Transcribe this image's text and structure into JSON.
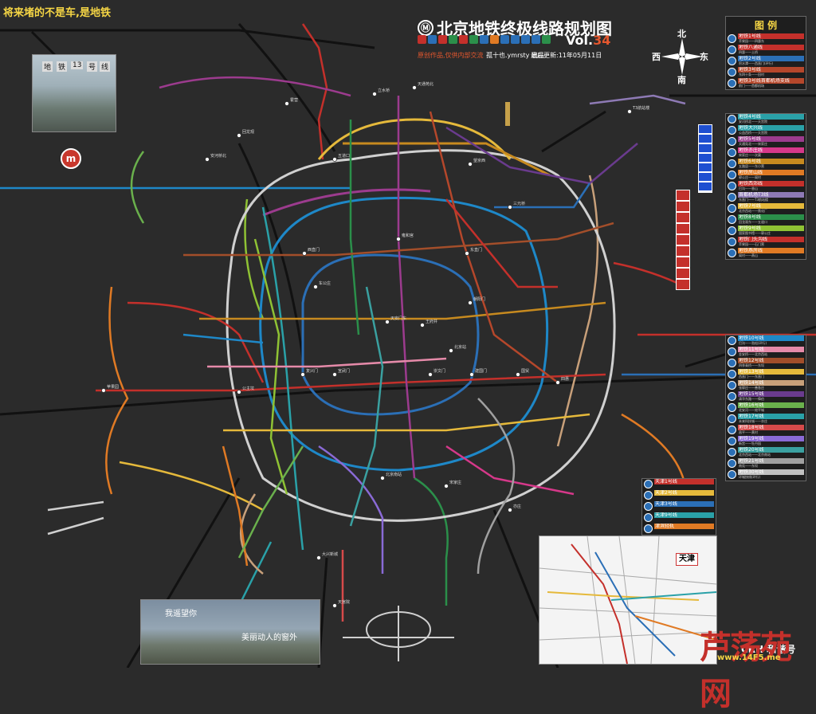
{
  "map": {
    "title": "北京地铁终极线路规划图",
    "vol_prefix": "Vol.",
    "vol_number": "34",
    "slogan": "将来堵的不是车,是地铁",
    "credit_left": "原创作品,仅供内部交流",
    "credit_author": "孤十也.ymrsty 出品",
    "updated": "最后更新:11年05月11日",
    "compass": {
      "north": "北",
      "south": "南",
      "west": "西",
      "east": "东"
    },
    "photo1_labels": [
      "地",
      "铁",
      "13",
      "号",
      "线"
    ],
    "photo2_caption_1": "我遥望你",
    "photo2_caption_2": "美丽动人的窗外",
    "inset_label": "天津",
    "watermark": "芦荡苑网",
    "watermark_url": "www.14F5.me",
    "crh_label": "CRH 和谐号",
    "logo_letter": "m"
  },
  "legend": {
    "title": "图 例",
    "group1": [
      {
        "name": "地铁1号线",
        "color": "#c4302b",
        "sub": "苹果园——四惠东"
      },
      {
        "name": "地铁八通线",
        "color": "#c4302b",
        "sub": "四惠——土桥"
      },
      {
        "name": "地铁2号线",
        "color": "#2b6fb6",
        "sub": "积水潭——西直门(环行)"
      },
      {
        "name": "地铁3号线",
        "color": "#b5472b",
        "sub": "东四十条——田村"
      },
      {
        "name": "地铁3号线首都机场支线",
        "color": "#b5472b",
        "sub": "前门——首都机场"
      }
    ],
    "group2": [
      {
        "name": "地铁4号线",
        "color": "#2aa1a8",
        "sub": "安河桥北——天宫院"
      },
      {
        "name": "地铁大兴线",
        "color": "#2aa1a8",
        "sub": "公益西桥——天宫院"
      },
      {
        "name": "地铁5号线",
        "color": "#9c3b8e",
        "sub": "天通苑北——宋家庄"
      },
      {
        "name": "地铁亦庄线",
        "color": "#d6388a",
        "sub": "宋家庄——次渠"
      },
      {
        "name": "地铁6号线",
        "color": "#c78a1f",
        "sub": "五路居——东小营"
      },
      {
        "name": "地铁房山线",
        "color": "#e07a24",
        "sub": "郭公庄——阎村"
      },
      {
        "name": "地铁西郊线",
        "color": "#c4302b",
        "sub": "巴沟——香山"
      },
      {
        "name": "首都机场T3线",
        "color": "#8e7ab5",
        "sub": "东直门——T3航站楼"
      },
      {
        "name": "地铁7号线",
        "color": "#e5b93b",
        "sub": "北京西站——焦化厂"
      },
      {
        "name": "地铁8号线",
        "color": "#2b8f4a",
        "sub": "回龙观东——五道口"
      },
      {
        "name": "地铁9号线",
        "color": "#8fc234",
        "sub": "国家图书馆——郭公庄"
      },
      {
        "name": "地铁门头沟线",
        "color": "#c4302b",
        "sub": "苹果园——石门营"
      },
      {
        "name": "地铁燕房线",
        "color": "#e07a24",
        "sub": "阎村——燕山"
      }
    ],
    "group3": [
      {
        "name": "地铁10号线",
        "color": "#1e88c8",
        "sub": "巴沟——劲松(环行)"
      },
      {
        "name": "地铁11号线",
        "color": "#e58aa9",
        "sub": "金安桥——北京西站"
      },
      {
        "name": "地铁12号线",
        "color": "#a34e2a",
        "sub": "四季青桥——东坝"
      },
      {
        "name": "地铁13号线",
        "color": "#e5b93b",
        "sub": "西直门——东直门"
      },
      {
        "name": "地铁14号线",
        "color": "#c8a07a",
        "sub": "张郭庄——善各庄"
      },
      {
        "name": "地铁15号线",
        "color": "#6a3b8e",
        "sub": "清华东路——俸伯"
      },
      {
        "name": "地铁16号线",
        "color": "#6ab04c",
        "sub": "北安河——宛平城"
      },
      {
        "name": "地铁17号线",
        "color": "#2aa1a8",
        "sub": "未来科技城——亦庄"
      },
      {
        "name": "地铁18号线",
        "color": "#d64a4a",
        "sub": "昌平——黄村"
      },
      {
        "name": "地铁19号线",
        "color": "#8a6ad6",
        "sub": "新宫——牡丹园"
      },
      {
        "name": "地铁20号线",
        "color": "#3aa0a0",
        "sub": "北京西站——北京南站"
      },
      {
        "name": "地铁21号线",
        "color": "#a0a0a0",
        "sub": "南苑——东坝"
      },
      {
        "name": "地铁30号线",
        "color": "#c0c0c0",
        "sub": "环城快线(环行)"
      }
    ],
    "mini": [
      {
        "name": "天津1号线",
        "color": "#c4302b"
      },
      {
        "name": "天津2号线",
        "color": "#e5b93b"
      },
      {
        "name": "天津3号线",
        "color": "#2b6fb6"
      },
      {
        "name": "天津9号线",
        "color": "#2aa1a8"
      },
      {
        "name": "津滨轻轨",
        "color": "#e07a24"
      }
    ]
  },
  "lines": {
    "colors": {
      "line1": "#c4302b",
      "line2": "#2b6fb6",
      "line4": "#2aa1a8",
      "line5": "#9c3b8e",
      "line6": "#c78a1f",
      "line7": "#e5b93b",
      "line8": "#2b8f4a",
      "line9": "#8fc234",
      "line10": "#1e88c8",
      "line13": "#e5b93b",
      "line14": "#c8a07a",
      "line15": "#6a3b8e",
      "line16": "#6ab04c",
      "airport": "#8e7ab5",
      "outer_ring": "#d0d0d0"
    }
  },
  "stations": [
    {
      "name": "西直门"
    },
    {
      "name": "东直门"
    },
    {
      "name": "建国门"
    },
    {
      "name": "复兴门"
    },
    {
      "name": "天安门东"
    },
    {
      "name": "王府井"
    },
    {
      "name": "北京站"
    },
    {
      "name": "崇文门"
    },
    {
      "name": "宣武门"
    },
    {
      "name": "车公庄"
    },
    {
      "name": "雍和宫"
    },
    {
      "name": "朝阳门"
    },
    {
      "name": "国贸"
    },
    {
      "name": "公主坟"
    },
    {
      "name": "五道口"
    },
    {
      "name": "回龙观"
    },
    {
      "name": "霍营"
    },
    {
      "name": "立水桥"
    },
    {
      "name": "望京西"
    },
    {
      "name": "三元桥"
    },
    {
      "name": "北京南站"
    },
    {
      "name": "宋家庄"
    },
    {
      "name": "苹果园"
    },
    {
      "name": "四惠"
    },
    {
      "name": "天通苑北"
    },
    {
      "name": "安河桥北"
    },
    {
      "name": "天宫院"
    },
    {
      "name": "T3航站楼"
    },
    {
      "name": "大兴新城"
    },
    {
      "name": "亦庄"
    }
  ]
}
